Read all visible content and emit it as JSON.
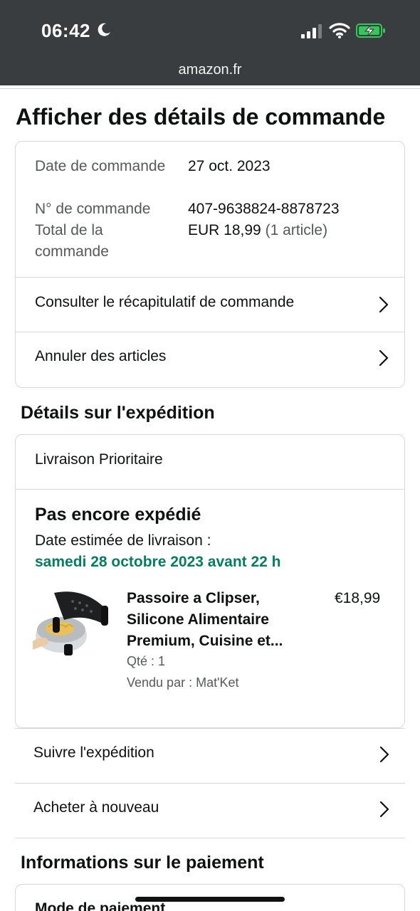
{
  "status_bar": {
    "time": "06:42",
    "url": "amazon.fr",
    "background": "#3a3d40",
    "battery_color": "#34c759"
  },
  "page": {
    "title": "Afficher des détails de commande"
  },
  "order_summary": {
    "date_label": "Date de commande",
    "date_value": "27 oct. 2023",
    "number_label": "N° de commande",
    "number_value": "407-9638824-8878723",
    "total_label": "Total de la commande",
    "total_value": "EUR 18,99",
    "total_count": "(1 article)",
    "links": [
      {
        "label": "Consulter le récapitulatif de commande",
        "icon": "chevron-right-icon"
      },
      {
        "label": "Annuler des articles",
        "icon": "chevron-right-icon"
      }
    ]
  },
  "shipping": {
    "section_title": "Détails sur l'expédition",
    "method": "Livraison Prioritaire",
    "status": "Pas encore expédié",
    "estimate_label": "Date estimée de livraison :",
    "estimate_date": "samedi 28 octobre 2023 avant 22 h",
    "estimate_color": "#067d62",
    "product": {
      "title": "Passoire a Clipser, Silicone Alimentaire Premium, Cuisine et...",
      "price": "€18,99",
      "quantity": "Qté : 1",
      "seller": "Vendu par : Mat'Ket",
      "image_icon": "colander-product-image"
    },
    "actions": [
      {
        "label": "Suivre l'expédition",
        "icon": "chevron-right-icon"
      },
      {
        "label": "Acheter à nouveau",
        "icon": "chevron-right-icon"
      }
    ]
  },
  "payment": {
    "section_title": "Informations sur le paiement",
    "card_label": "Mode de paiement"
  }
}
